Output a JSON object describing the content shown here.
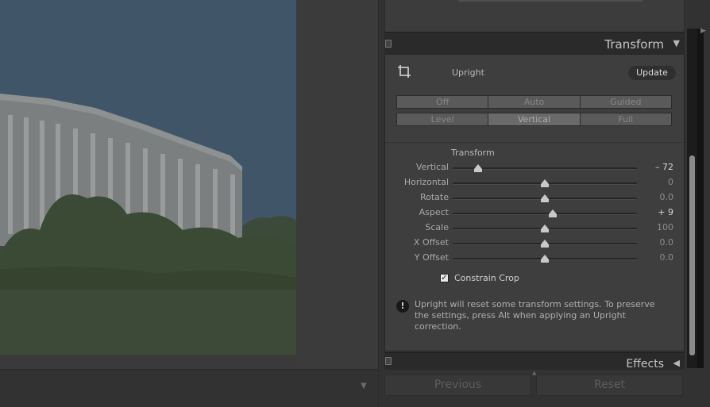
{
  "transform": {
    "header_title": "Transform",
    "upright_label": "Upright",
    "update_label": "Update",
    "upright_modes_row1": [
      "Off",
      "Auto",
      "Guided"
    ],
    "upright_modes_row2": [
      "Level",
      "Vertical",
      "Full"
    ],
    "selected_mode": "Vertical",
    "subsection_label": "Transform",
    "sliders": [
      {
        "label": "Vertical",
        "value": "– 72",
        "level": -72,
        "min": -100,
        "max": 100
      },
      {
        "label": "Horizontal",
        "value": "0",
        "level": 0,
        "min": -100,
        "max": 100
      },
      {
        "label": "Rotate",
        "value": "0.0",
        "level": 0,
        "min": -10,
        "max": 10
      },
      {
        "label": "Aspect",
        "value": "+ 9",
        "level": 9,
        "min": -100,
        "max": 100
      },
      {
        "label": "Scale",
        "value": "100",
        "level": 100,
        "min": 50,
        "max": 150
      },
      {
        "label": "X Offset",
        "value": "0.0",
        "level": 0,
        "min": -100,
        "max": 100
      },
      {
        "label": "Y Offset",
        "value": "0.0",
        "level": 0,
        "min": -100,
        "max": 100
      }
    ],
    "constrain_crop_label": "Constrain Crop",
    "constrain_crop_checked": true,
    "info_text": "Upright will reset some transform settings. To preserve the settings, press Alt when applying an Upright correction."
  },
  "effects": {
    "header_title": "Effects"
  },
  "nav": {
    "previous_label": "Previous",
    "reset_label": "Reset"
  },
  "icons": {
    "crop": "crop-icon",
    "info": "exclamation-icon",
    "collapse": "triangle-down-icon",
    "expand": "triangle-left-icon",
    "filmstrip_toggle": "triangle-down-icon"
  }
}
